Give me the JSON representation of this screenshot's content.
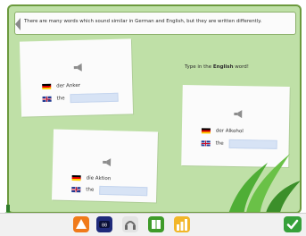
{
  "header": {
    "instruction": "There are many words which sound similar in German and English, but they are written differently."
  },
  "prompt": {
    "before": "Type in the ",
    "bold": "English",
    "after": " word!"
  },
  "cards": [
    {
      "german_word": "der Anker",
      "english_prefix": "the",
      "answer_value": ""
    },
    {
      "german_word": "der Alkohol",
      "english_prefix": "the",
      "answer_value": ""
    },
    {
      "german_word": "die Aktion",
      "english_prefix": "the",
      "answer_value": ""
    }
  ],
  "icons": {
    "speaker": "speaker-icon",
    "german_flag": "german-flag-icon",
    "uk_flag": "uk-flag-icon",
    "bottle": "bottle-icon",
    "warning": "warning-icon",
    "clock": "clock-icon",
    "headphones": "headphones-icon",
    "book": "book-icon",
    "chart": "chart-icon",
    "check": "check-icon"
  },
  "colors": {
    "board_bg": "#bfe0a7",
    "input_bg": "#d7e3f5",
    "accent_orange": "#f07a1a",
    "accent_green": "#3f9b2a"
  }
}
